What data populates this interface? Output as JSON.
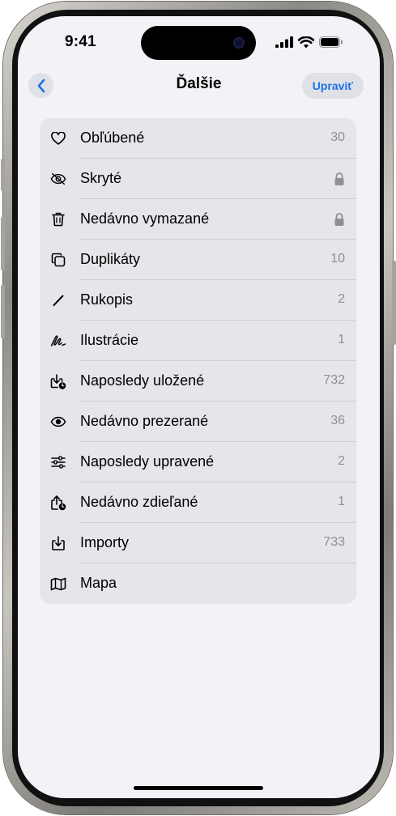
{
  "status_bar": {
    "time": "9:41",
    "icons": [
      "signal-icon",
      "wifi-icon",
      "battery-icon"
    ]
  },
  "nav": {
    "back_icon": "chevron-left-icon",
    "title": "Ďalšie",
    "edit_label": "Upraviť"
  },
  "colors": {
    "accent": "#1a73e8",
    "background": "#f2f2f7",
    "card": "#e5e5ea",
    "secondary_text": "#8e8e93"
  },
  "list": {
    "items": [
      {
        "icon": "heart-icon",
        "label": "Obľúbené",
        "count": "30"
      },
      {
        "icon": "eye-slash-icon",
        "label": "Skryté",
        "count": "",
        "locked": true
      },
      {
        "icon": "trash-icon",
        "label": "Nedávno vymazané",
        "count": "",
        "locked": true
      },
      {
        "icon": "duplicate-icon",
        "label": "Duplikáty",
        "count": "10"
      },
      {
        "icon": "pen-icon",
        "label": "Rukopis",
        "count": "2"
      },
      {
        "icon": "scribble-icon",
        "label": "Ilustrácie",
        "count": "1"
      },
      {
        "icon": "saved-download-icon",
        "label": "Naposledy uložené",
        "count": "732"
      },
      {
        "icon": "eye-icon",
        "label": "Nedávno prezerané",
        "count": "36"
      },
      {
        "icon": "sliders-icon",
        "label": "Naposledy upravené",
        "count": "2"
      },
      {
        "icon": "share-clock-icon",
        "label": "Nedávno zdieľané",
        "count": "1"
      },
      {
        "icon": "import-icon",
        "label": "Importy",
        "count": "733"
      },
      {
        "icon": "map-icon",
        "label": "Mapa",
        "count": ""
      }
    ]
  }
}
